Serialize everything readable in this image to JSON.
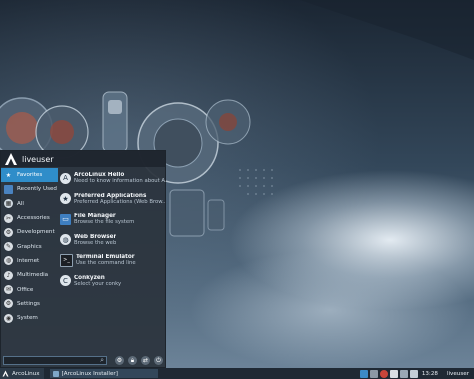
{
  "menu": {
    "username": "liveuser",
    "categories": [
      {
        "label": "Favorites",
        "icon": "star-icon",
        "active": true
      },
      {
        "label": "Recently Used",
        "icon": "folder-icon"
      },
      {
        "label": "All",
        "icon": "grid-icon"
      },
      {
        "label": "Accessories",
        "icon": "accessories-icon"
      },
      {
        "label": "Development",
        "icon": "development-icon"
      },
      {
        "label": "Graphics",
        "icon": "graphics-icon"
      },
      {
        "label": "Internet",
        "icon": "globe-icon"
      },
      {
        "label": "Multimedia",
        "icon": "multimedia-icon"
      },
      {
        "label": "Office",
        "icon": "office-icon"
      },
      {
        "label": "Settings",
        "icon": "settings-icon"
      },
      {
        "label": "System",
        "icon": "system-icon"
      }
    ],
    "apps": [
      {
        "name": "ArcoLinux Hello",
        "desc": "Need to know information about A..."
      },
      {
        "name": "Preferred Applications",
        "desc": "Preferred Applications (Web Brow..."
      },
      {
        "name": "File Manager",
        "desc": "Browse the file system"
      },
      {
        "name": "Web Browser",
        "desc": "Browse the web"
      },
      {
        "name": "Terminal Emulator",
        "desc": "Use the command line"
      },
      {
        "name": "Conkyzen",
        "desc": "Select your conky"
      }
    ]
  },
  "panel": {
    "start_label": "ArcoLinux",
    "task_label": "[ArcoLinux Installer]",
    "clock": "13:28",
    "user": "liveuser"
  },
  "colors": {
    "accent": "#2f8dc9",
    "panel": "#1f2934",
    "menu_bg": "#2c343e"
  }
}
